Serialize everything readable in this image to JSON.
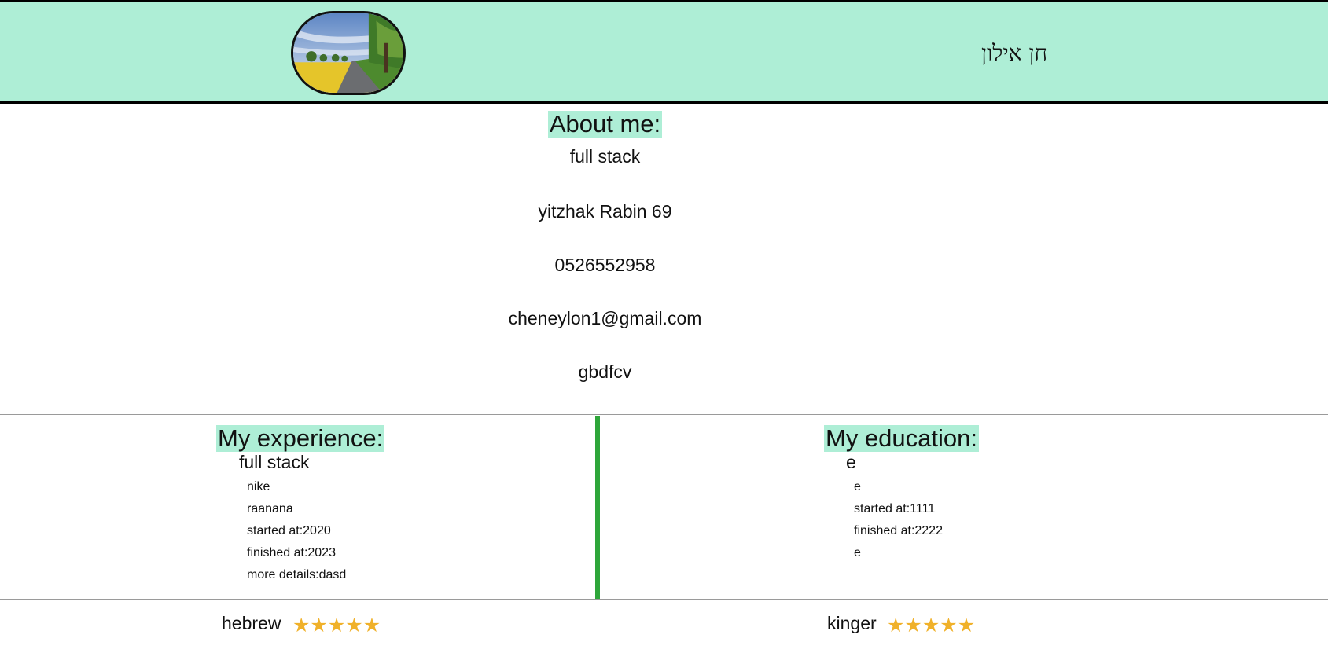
{
  "header": {
    "name": "חן אילון",
    "avatar_alt": "landscape-photo"
  },
  "about": {
    "title": "About me:",
    "lines": [
      "full stack",
      "yitzhak Rabin 69",
      "0526552958",
      "cheneylon1@gmail.com",
      "gbdfcv"
    ]
  },
  "experience": {
    "title": "My experience:",
    "job_title": "full stack",
    "company": "nike",
    "location": "raanana",
    "started": "started at:2020",
    "finished": "finished at:2023",
    "details": "more details:dasd"
  },
  "education": {
    "title": "My education:",
    "degree": "e",
    "institution": "e",
    "started": "started at:1111",
    "finished": "finished at:2222",
    "details": "e"
  },
  "skills": [
    {
      "name": "hebrew",
      "rating": 5,
      "max": 5
    },
    {
      "name": "kinger",
      "rating": 5,
      "max": 5
    }
  ],
  "colors": {
    "header_bg": "#aeeed6",
    "divider": "#2ea63a",
    "star": "#f0b12a"
  }
}
